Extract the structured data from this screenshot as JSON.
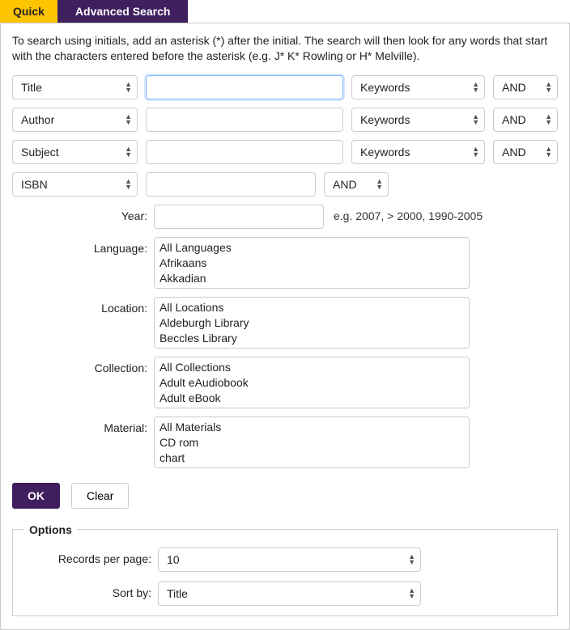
{
  "tabs": {
    "quick": "Quick",
    "advanced": "Advanced Search"
  },
  "instructions": "To search using initials, add an asterisk (*) after the initial. The search will then look for any words that start with the characters entered before the asterisk (e.g. J* K* Rowling or H* Melville).",
  "rows": [
    {
      "field": "Title",
      "value": "",
      "match": "Keywords",
      "op": "AND"
    },
    {
      "field": "Author",
      "value": "",
      "match": "Keywords",
      "op": "AND"
    },
    {
      "field": "Subject",
      "value": "",
      "match": "Keywords",
      "op": "AND"
    },
    {
      "field": "ISBN",
      "value": "",
      "op4": "AND"
    }
  ],
  "year": {
    "label": "Year:",
    "value": "",
    "hint": "e.g. 2007, > 2000, 1990-2005"
  },
  "language": {
    "label": "Language:",
    "options": [
      "All Languages",
      "Afrikaans",
      "Akkadian"
    ]
  },
  "location": {
    "label": "Location:",
    "options": [
      "All Locations",
      "Aldeburgh Library",
      "Beccles Library"
    ]
  },
  "collection": {
    "label": "Collection:",
    "options": [
      "All Collections",
      "Adult eAudiobook",
      "Adult eBook"
    ]
  },
  "material": {
    "label": "Material:",
    "options": [
      "All Materials",
      "CD rom",
      "chart"
    ]
  },
  "buttons": {
    "ok": "OK",
    "clear": "Clear"
  },
  "options": {
    "legend": "Options",
    "records_label": "Records per page:",
    "records_value": "10",
    "sort_label": "Sort by:",
    "sort_value": "Title"
  }
}
